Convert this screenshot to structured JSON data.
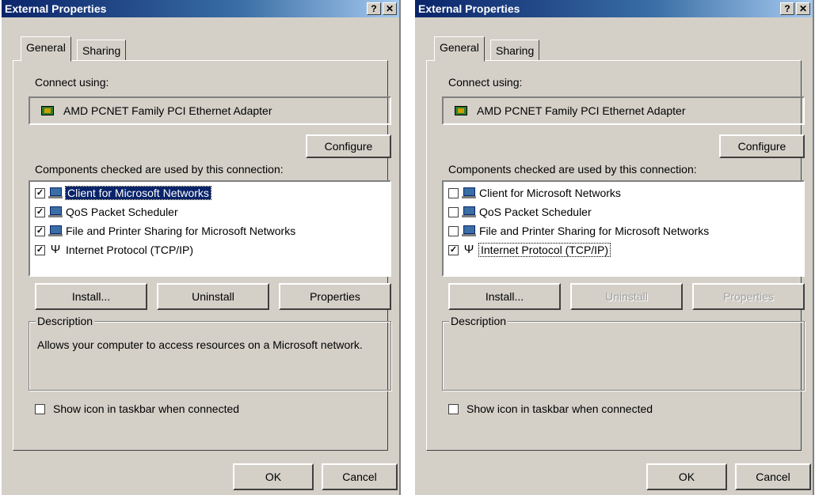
{
  "windows": [
    {
      "title": "External Properties",
      "help_button": "?",
      "close_button": "✕",
      "tabs": [
        "General",
        "Sharing"
      ],
      "connect_using_label": "Connect using:",
      "adapter_name": "AMD PCNET Family PCI Ethernet Adapter",
      "configure_button": "Configure",
      "components_label": "Components checked are used by this connection:",
      "components": [
        {
          "label": "Client for Microsoft Networks",
          "checked": true,
          "icon": "network-client-icon",
          "selected": true
        },
        {
          "label": "QoS Packet Scheduler",
          "checked": true,
          "icon": "network-service-icon",
          "selected": false
        },
        {
          "label": "File and Printer Sharing for Microsoft Networks",
          "checked": true,
          "icon": "network-service-icon",
          "selected": false
        },
        {
          "label": "Internet Protocol (TCP/IP)",
          "checked": true,
          "icon": "protocol-icon",
          "selected": false
        }
      ],
      "install_button": "Install...",
      "uninstall_button": "Uninstall",
      "properties_button": "Properties",
      "buttons_disabled": false,
      "description_title": "Description",
      "description_text": "Allows your computer to access resources on a Microsoft network.",
      "show_icon_label": "Show icon in taskbar when connected",
      "show_icon_checked": false,
      "ok_button": "OK",
      "cancel_button": "Cancel"
    },
    {
      "title": "External Properties",
      "help_button": "?",
      "close_button": "✕",
      "tabs": [
        "General",
        "Sharing"
      ],
      "connect_using_label": "Connect using:",
      "adapter_name": "AMD PCNET Family PCI Ethernet Adapter",
      "configure_button": "Configure",
      "components_label": "Components checked are used by this connection:",
      "components": [
        {
          "label": "Client for Microsoft Networks",
          "checked": false,
          "icon": "network-client-icon",
          "selected": false
        },
        {
          "label": "QoS Packet Scheduler",
          "checked": false,
          "icon": "network-service-icon",
          "selected": false
        },
        {
          "label": "File and Printer Sharing for Microsoft Networks",
          "checked": false,
          "icon": "network-service-icon",
          "selected": false
        },
        {
          "label": "Internet Protocol (TCP/IP)",
          "checked": true,
          "icon": "protocol-icon",
          "focused": true
        }
      ],
      "install_button": "Install...",
      "uninstall_button": "Uninstall",
      "properties_button": "Properties",
      "buttons_disabled": true,
      "description_title": "Description",
      "description_text": "",
      "show_icon_label": "Show icon in taskbar when connected",
      "show_icon_checked": false,
      "ok_button": "OK",
      "cancel_button": "Cancel"
    }
  ],
  "colors": {
    "titlebar_start": "#0a246a",
    "titlebar_end": "#a6caf0",
    "dialog_face": "#d4d0c8",
    "selection": "#0a246a"
  }
}
